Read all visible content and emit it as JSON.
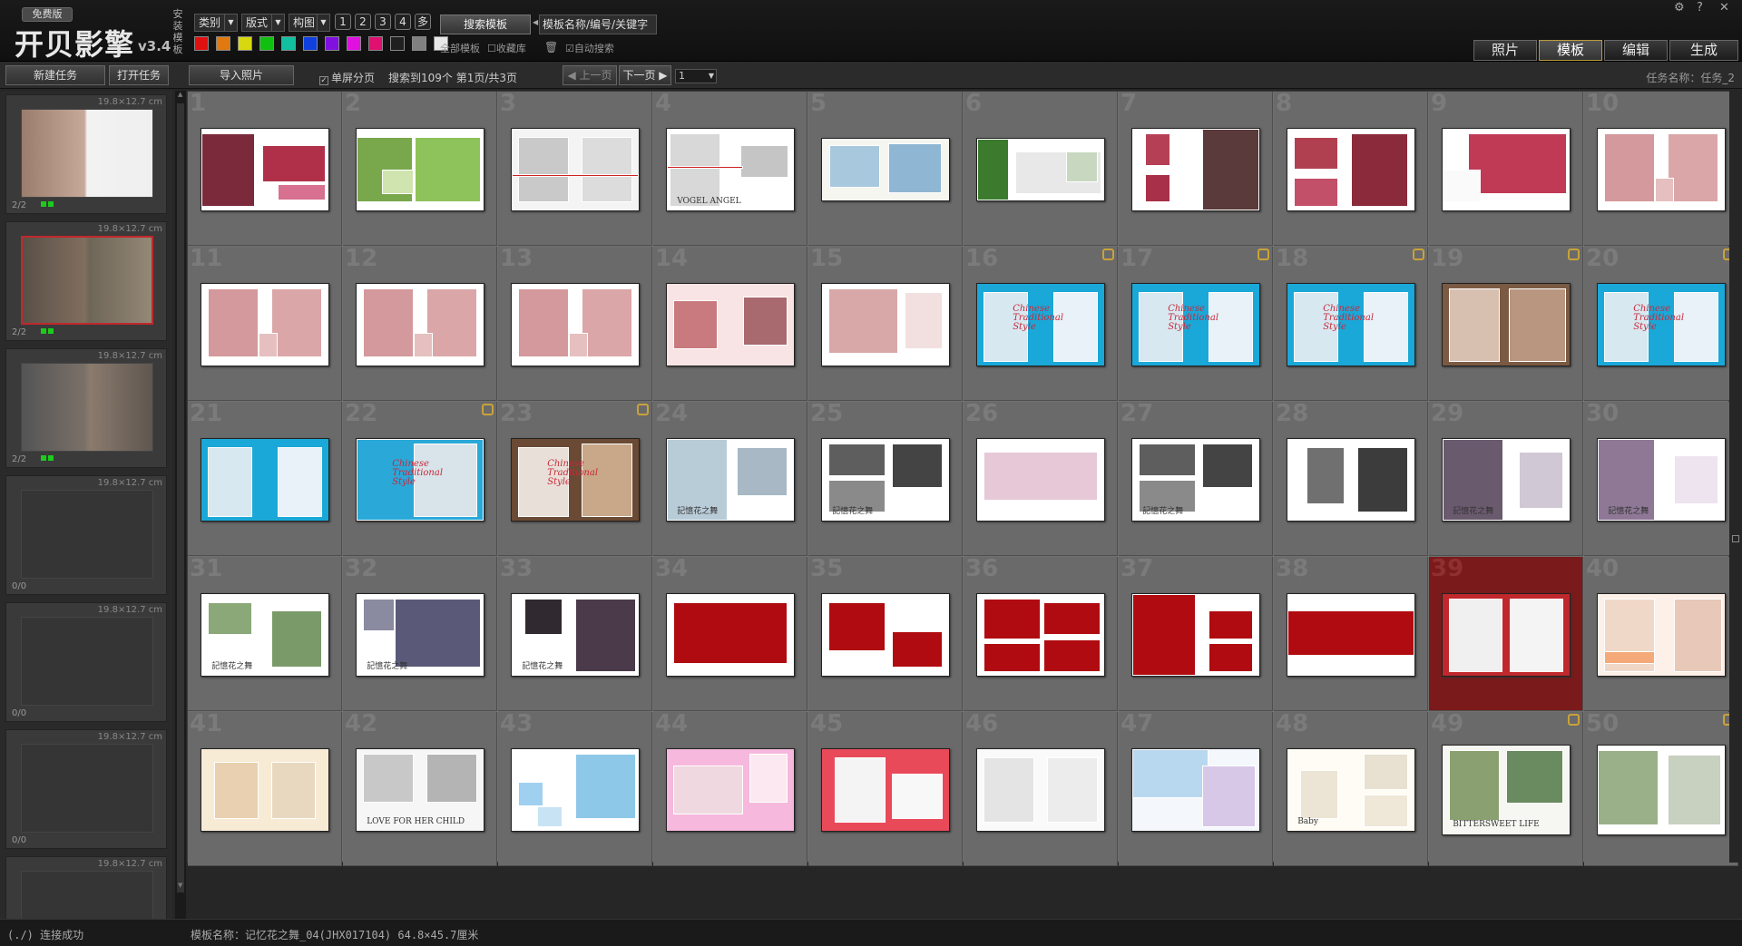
{
  "app": {
    "edition": "免费版",
    "logo": "开贝影擎",
    "version": "v3.4",
    "vertical_label": "安装模板"
  },
  "filters": {
    "category": "类别",
    "layout": "版式",
    "composition": "构图",
    "pages": [
      "1",
      "2",
      "3",
      "4",
      "多"
    ]
  },
  "color_swatches": [
    "#e01010",
    "#e07a10",
    "#d8d810",
    "#10c010",
    "#10c0a0",
    "#1040e0",
    "#8010e0",
    "#e010e0",
    "#e01070",
    "#202020",
    "#808080",
    "#e8e8e8"
  ],
  "search": {
    "button": "搜索模板",
    "placeholder": "模板名称/编号/关键字",
    "all_templates": "全部模板",
    "favorites": "收藏库",
    "auto_search": "自动搜索"
  },
  "main_tabs": [
    "照片",
    "模板",
    "编辑",
    "生成"
  ],
  "active_tab": "模板",
  "window_controls": [
    "⚙",
    "?",
    "✕"
  ],
  "toolbar": {
    "new_task": "新建任务",
    "open_task": "打开任务",
    "import_photos": "导入照片",
    "single_page": "单屏分页",
    "result": "搜索到109个 第1页/共3页",
    "prev": "上一页",
    "next": "下一页",
    "page_value": "1",
    "task_name": "任务名称：任务_2"
  },
  "tasks": [
    {
      "size": "19.8×12.7 cm",
      "count": "2/2",
      "filled": true
    },
    {
      "size": "19.8×12.7 cm",
      "count": "2/2",
      "filled": true
    },
    {
      "size": "19.8×12.7 cm",
      "count": "2/2",
      "filled": true
    },
    {
      "size": "19.8×12.7 cm",
      "count": "0/0",
      "filled": false
    },
    {
      "size": "19.8×12.7 cm",
      "count": "0/0",
      "filled": false
    },
    {
      "size": "19.8×12.7 cm",
      "count": "0/0",
      "filled": false
    },
    {
      "size": "19.8×12.7 cm",
      "count": "",
      "filled": false
    }
  ],
  "templates": [
    {
      "n": "1",
      "style": "roses"
    },
    {
      "n": "2",
      "style": "green"
    },
    {
      "n": "3",
      "style": "white-red"
    },
    {
      "n": "4",
      "style": "vogel",
      "text": "VOGEL ANGEL"
    },
    {
      "n": "5",
      "style": "baby-blue"
    },
    {
      "n": "6",
      "style": "green2"
    },
    {
      "n": "7",
      "style": "roses2"
    },
    {
      "n": "8",
      "style": "roses3"
    },
    {
      "n": "9",
      "style": "roses4"
    },
    {
      "n": "10",
      "style": "pink"
    },
    {
      "n": "11",
      "style": "pink"
    },
    {
      "n": "12",
      "style": "pink"
    },
    {
      "n": "13",
      "style": "pink"
    },
    {
      "n": "14",
      "style": "pink-circle"
    },
    {
      "n": "15",
      "style": "pink2"
    },
    {
      "n": "16",
      "style": "blue",
      "lock": true,
      "text": "Chinese Traditional Style"
    },
    {
      "n": "17",
      "style": "blue",
      "lock": true,
      "text": "Chinese Traditional Style"
    },
    {
      "n": "18",
      "style": "blue",
      "lock": true,
      "text": "Chinese Traditional Style"
    },
    {
      "n": "19",
      "style": "brown-flower",
      "lock": true
    },
    {
      "n": "20",
      "style": "blue",
      "lock": true,
      "text": "Chinese Traditional Style"
    },
    {
      "n": "21",
      "style": "blue"
    },
    {
      "n": "22",
      "style": "blue-porcelain",
      "lock": true,
      "text": "Chinese Traditional Style"
    },
    {
      "n": "23",
      "style": "brown",
      "lock": true,
      "text": "Chinese Traditional Style"
    },
    {
      "n": "24",
      "style": "white-blue",
      "text": "記憶花之舞"
    },
    {
      "n": "25",
      "style": "gray-bw",
      "text": "記憶花之舞"
    },
    {
      "n": "26",
      "style": "white-pink"
    },
    {
      "n": "27",
      "style": "gray-bw",
      "text": "記憶花之舞"
    },
    {
      "n": "28",
      "style": "white-bw"
    },
    {
      "n": "29",
      "style": "purple",
      "text": "記憶花之舞"
    },
    {
      "n": "30",
      "style": "purple2",
      "text": "記憶花之舞"
    },
    {
      "n": "31",
      "style": "white-green",
      "text": "記憶花之舞"
    },
    {
      "n": "32",
      "style": "white-purple",
      "text": "記憶花之舞"
    },
    {
      "n": "33",
      "style": "white-dark",
      "text": "記憶花之舞"
    },
    {
      "n": "34",
      "style": "red-empty"
    },
    {
      "n": "35",
      "style": "red-2"
    },
    {
      "n": "36",
      "style": "red-4"
    },
    {
      "n": "37",
      "style": "red-3"
    },
    {
      "n": "38",
      "style": "red-wide"
    },
    {
      "n": "39",
      "style": "red-couple",
      "selected": true
    },
    {
      "n": "40",
      "style": "peach-baby"
    },
    {
      "n": "41",
      "style": "cream-baby"
    },
    {
      "n": "42",
      "style": "baby-bw",
      "text": "LOVE FOR HER CHILD"
    },
    {
      "n": "43",
      "style": "baby-blue2"
    },
    {
      "n": "44",
      "style": "baby-pink"
    },
    {
      "n": "45",
      "style": "baby-red"
    },
    {
      "n": "46",
      "style": "baby-white"
    },
    {
      "n": "47",
      "style": "baby-light"
    },
    {
      "n": "48",
      "style": "baby-cream",
      "text": "Baby"
    },
    {
      "n": "49",
      "style": "wedding-green",
      "lock": true,
      "text": "BITTERSWEET LIFE"
    },
    {
      "n": "50",
      "style": "wedding-green2",
      "lock": true
    }
  ],
  "status": {
    "connection": "(./) 连接成功",
    "template_info": "模板名称：记忆花之舞_04(JHX017104) 64.8×45.7厘米"
  }
}
